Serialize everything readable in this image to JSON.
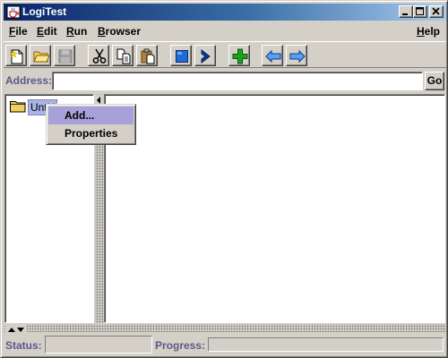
{
  "window": {
    "title": "LogiTest"
  },
  "menubar": {
    "items": [
      {
        "mnemonic": "F",
        "rest": "ile"
      },
      {
        "mnemonic": "E",
        "rest": "dit"
      },
      {
        "mnemonic": "R",
        "rest": "un"
      },
      {
        "mnemonic": "B",
        "rest": "rowser"
      },
      {
        "mnemonic": "H",
        "rest": "elp"
      }
    ]
  },
  "toolbar": {
    "buttons": [
      {
        "icon": "new-document-icon",
        "enabled": true
      },
      {
        "icon": "open-folder-icon",
        "enabled": true
      },
      {
        "icon": "save-disk-icon",
        "enabled": false
      },
      {
        "icon": "cut-scissors-icon",
        "enabled": true
      },
      {
        "icon": "copy-icon",
        "enabled": true
      },
      {
        "icon": "paste-icon",
        "enabled": true
      },
      {
        "icon": "stop-square-icon",
        "enabled": true
      },
      {
        "icon": "run-chevron-icon",
        "enabled": true
      },
      {
        "icon": "add-plus-icon",
        "enabled": true
      },
      {
        "icon": "back-arrow-icon",
        "enabled": true
      },
      {
        "icon": "forward-arrow-icon",
        "enabled": true
      }
    ]
  },
  "address": {
    "label": "Address:",
    "value": "",
    "go_label": "Go"
  },
  "tree": {
    "root_label": "Untitl"
  },
  "context_menu": {
    "items": [
      "Add...",
      "Properties"
    ],
    "highlighted": "Add..."
  },
  "status": {
    "label": "Status:",
    "value": "",
    "progress_label": "Progress:",
    "progress": 0
  },
  "colors": {
    "title_gradient_start": "#0a246a",
    "title_gradient_end": "#a6caf0",
    "face": "#d4d0c8",
    "label_blue": "#5a5a8c",
    "selection": "#a8a0d8"
  }
}
